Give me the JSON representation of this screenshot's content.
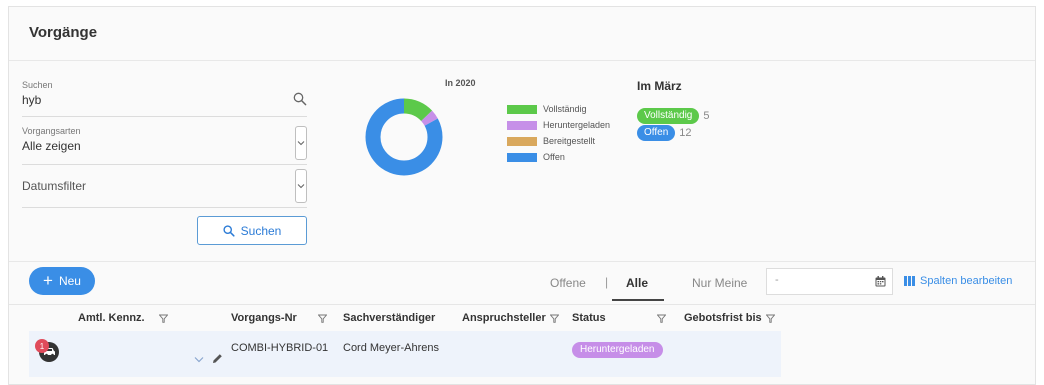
{
  "page": {
    "title": "Vorgänge"
  },
  "filters": {
    "search": {
      "label": "Suchen",
      "value": "hyb"
    },
    "type": {
      "label": "Vorgangsarten",
      "value": "Alle zeigen"
    },
    "date": {
      "label": "Datumsfilter"
    },
    "search_button": "Suchen"
  },
  "chart_data": {
    "type": "pie",
    "title": "In 2020",
    "donut": true,
    "series": [
      {
        "name": "Vollständig",
        "value": 13,
        "color": "#5cc94a"
      },
      {
        "name": "Heruntergeladen",
        "value": 4,
        "color": "#c690e8"
      },
      {
        "name": "Bereitgestellt",
        "value": 0,
        "color": "#d9a85d"
      },
      {
        "name": "Offen",
        "value": 83,
        "color": "#3a8ee6"
      }
    ]
  },
  "month": {
    "title": "Im März",
    "items": [
      {
        "label": "Vollständig",
        "count": "5",
        "color": "#5cc94a"
      },
      {
        "label": "Offen",
        "count": "12",
        "color": "#3a8ee6"
      }
    ]
  },
  "toolbar": {
    "new_button": "Neu",
    "tabs": [
      "Offene",
      "Alle",
      "Nur Meine"
    ],
    "separator": "|",
    "date_placeholder": "-",
    "columns_link": "Spalten bearbeiten"
  },
  "table": {
    "columns": [
      "Amtl. Kennz.",
      "Vorgangs-Nr",
      "Sachverständiger",
      "Anspruchsteller",
      "Status",
      "Gebotsfrist bis"
    ],
    "rows": [
      {
        "badge": "1",
        "vorgangs_nr": "COMBI-HYBRID-01",
        "sachverstaendiger": "Cord Meyer-Ahrens",
        "status": "Heruntergeladen"
      }
    ]
  }
}
